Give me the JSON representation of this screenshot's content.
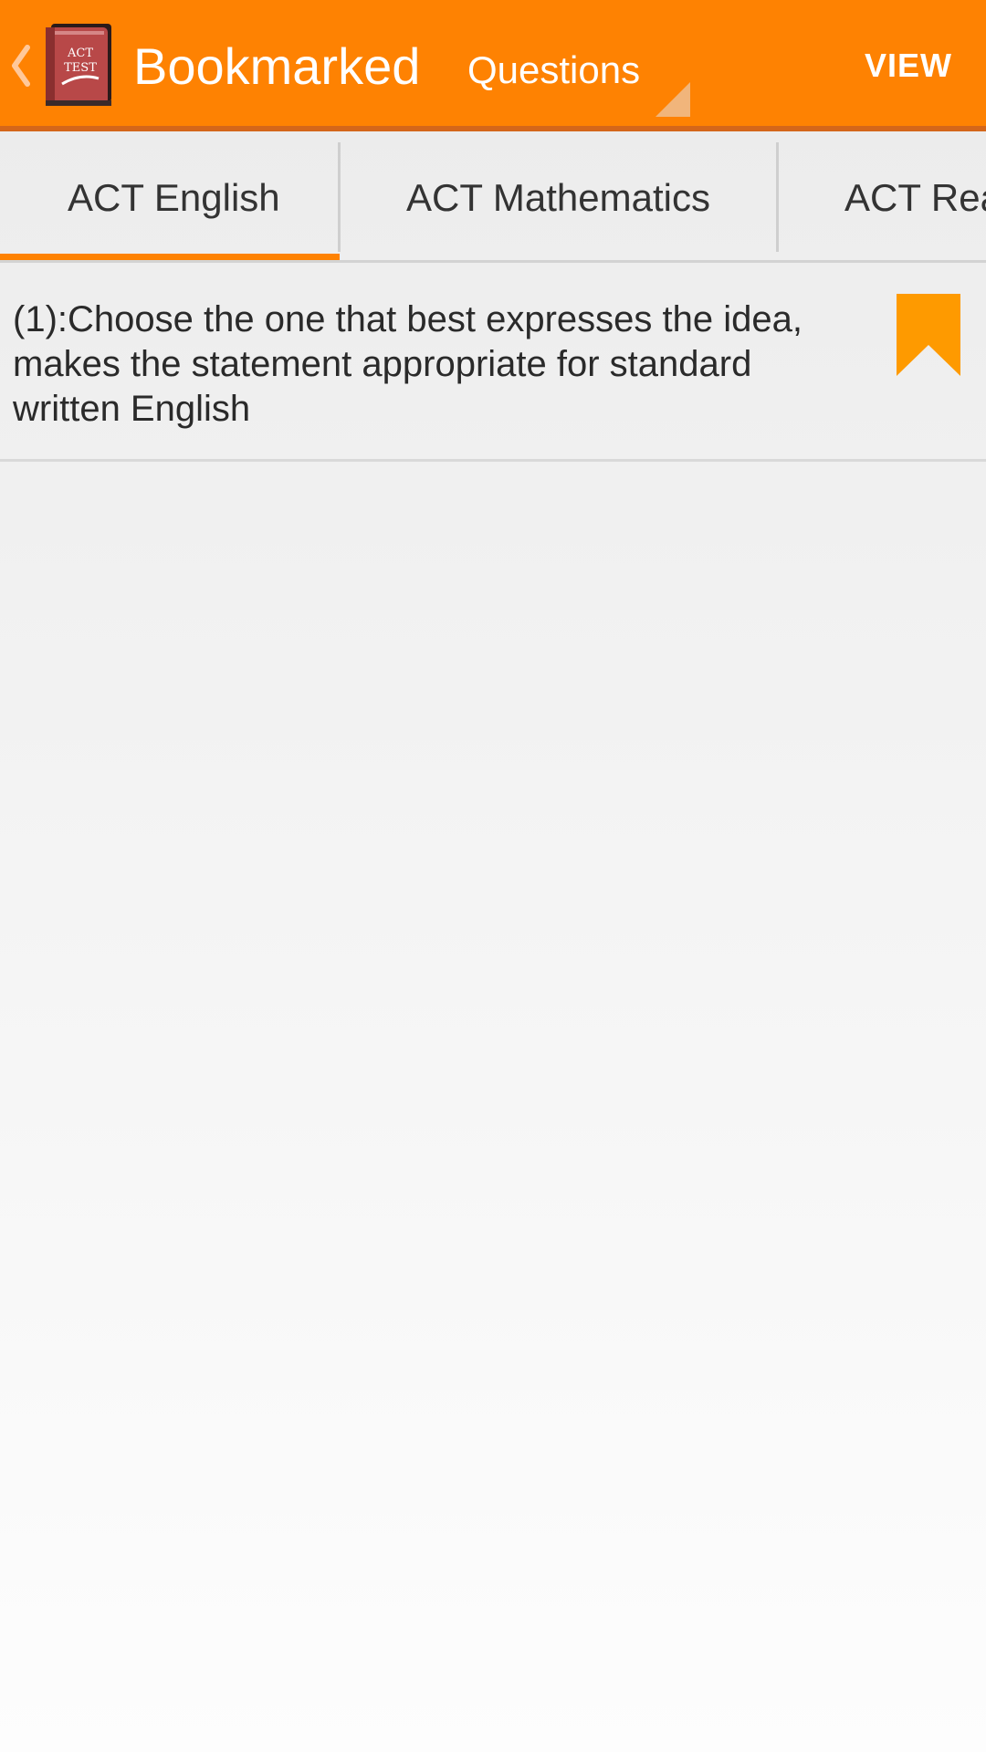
{
  "action_bar": {
    "title": "Bookmarked",
    "app_icon_text_line1": "ACT",
    "app_icon_text_line2": "TEST",
    "spinner_value": "Questions",
    "view_label": "VIEW"
  },
  "tabs": [
    {
      "label": "ACT English",
      "selected": true
    },
    {
      "label": "ACT Mathematics",
      "selected": false
    },
    {
      "label": "ACT Reading",
      "selected": false
    }
  ],
  "list": {
    "items": [
      {
        "question": "(1):Choose the one that best expresses the idea, makes the statement appropriate for standard written English",
        "bookmarked": true
      }
    ]
  },
  "colors": {
    "accent": "#fe8202",
    "accent_dark": "#d4661a",
    "bookmark": "#fe9a00",
    "text": "#2a2a2a"
  },
  "icons": [
    "back-chevron-icon",
    "app-book-icon",
    "spinner-corner-icon",
    "bookmark-icon"
  ]
}
